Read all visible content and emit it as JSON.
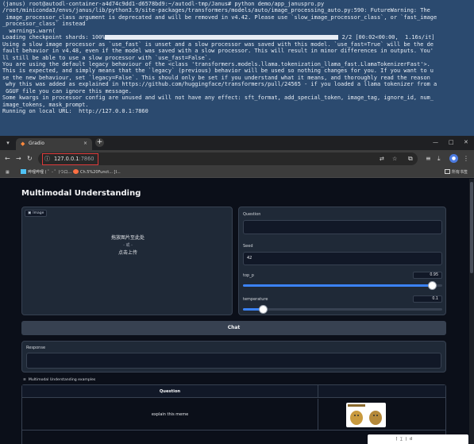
{
  "terminal": {
    "lines": [
      "(janus) root@autodl-container-a4d74c9dd1-d6578bd9:~/autodl-tmp/Janus# python demo/app_januspro.py",
      "/root/miniconda3/envs/janus/lib/python3.9/site-packages/transformers/models/auto/image_processing_auto.py:590: FutureWarning: The",
      " image_processor_class argument is deprecated and will be removed in v4.42. Please use `slow_image_processor_class`, or `fast_image",
      "_processor_class` instead",
      "  warnings.warn(",
      "Using a slow image processor as `use_fast` is unset and a slow processor was saved with this model. `use_fast=True` will be the de",
      "fault behavior in v4.48, even if the model was saved with a slow processor. This will result in minor differences in outputs. You'",
      "ll still be able to use a slow processor with `use_fast=False`.",
      "You are using the default legacy behaviour of the <class 'transformers.models.llama.tokenization_llama_fast.LlamaTokenizerFast'>.",
      "This is expected, and simply means that the `legacy` (previous) behavior will be used so nothing changes for you. If you want to u",
      "se the new behaviour, set `legacy=False`. This should only be set if you understand what it means, and thoroughly read the reason",
      " why this was added as explained in https://github.com/huggingface/transformers/pull/24565 - if you loaded a llama tokenizer from a",
      " GGUF file you can ignore this message.",
      "Some kwargs in processor config are unused and will not have any effect: sft_format, add_special_token, image_tag, ignore_id, num_",
      "image_tokens, mask_prompt.",
      "Running on local URL:  http://127.0.0.1:7860"
    ],
    "progress": {
      "prefix": "Loading checkpoint shards: 100%",
      "suffix": " 2/2 [00:02<00:00,  1.16s/it]",
      "fraction": 1.0
    }
  },
  "browser": {
    "tab_title": "Gradio",
    "tab_close": "×",
    "new_tab": "+",
    "url_host": "127.0.0.1",
    "url_port": ":7860",
    "bookmarks": [
      "哔哩哔哩 ( ゜- ゜)つロ...",
      "Ch.5%20Funct... [I...",
      "所有书签"
    ]
  },
  "gradio": {
    "title": "Multimodal Understanding",
    "image_label": "Image",
    "drop_line1": "拖放图片至此处",
    "drop_line2": "- 或 -",
    "drop_line3": "点击上传",
    "question_label": "Question",
    "question_value": "",
    "seed_label": "Seed",
    "seed_value": "42",
    "top_p_label": "top_p",
    "top_p_value": "0.95",
    "top_p_fraction": 0.95,
    "temperature_label": "temperature",
    "temperature_value": "0.1",
    "temperature_fraction": 0.1,
    "chat_button": "Chat",
    "response_label": "Response",
    "response_value": "",
    "examples_label": "Multimodal Understanding examples",
    "examples_header": "Question",
    "examples": [
      {
        "question": "explain this meme"
      }
    ]
  },
  "colors": {
    "accent": "#3b82f6",
    "page_bg": "#0b0f19",
    "panel_bg": "#1f2937",
    "terminal_bg": "#2b4a6f",
    "url_highlight": "#e03a3a"
  }
}
